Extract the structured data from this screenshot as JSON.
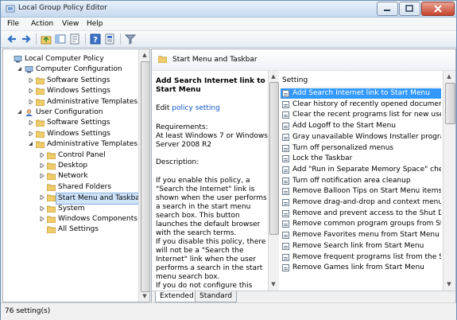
{
  "window": {
    "title": "Local Group Policy Editor"
  },
  "menu": [
    "File",
    "Action",
    "View",
    "Help"
  ],
  "toolbar_icons": [
    "back-arrow-icon",
    "forward-arrow-icon",
    "up-folder-icon",
    "show-hide-tree-icon",
    "export-list-icon",
    "help-icon",
    "properties-icon",
    "filter-icon"
  ],
  "tree": [
    {
      "label": "Local Computer Policy",
      "level": 0,
      "expander": "none",
      "icon": "computer"
    },
    {
      "label": "Computer Configuration",
      "level": 1,
      "expander": "open",
      "icon": "computer"
    },
    {
      "label": "Software Settings",
      "level": 2,
      "expander": "closed",
      "icon": "folder"
    },
    {
      "label": "Windows Settings",
      "level": 2,
      "expander": "closed",
      "icon": "folder"
    },
    {
      "label": "Administrative Templates",
      "level": 2,
      "expander": "closed",
      "icon": "folder"
    },
    {
      "label": "User Configuration",
      "level": 1,
      "expander": "open",
      "icon": "user"
    },
    {
      "label": "Software Settings",
      "level": 2,
      "expander": "closed",
      "icon": "folder"
    },
    {
      "label": "Windows Settings",
      "level": 2,
      "expander": "closed",
      "icon": "folder"
    },
    {
      "label": "Administrative Templates",
      "level": 2,
      "expander": "open",
      "icon": "folder"
    },
    {
      "label": "Control Panel",
      "level": 3,
      "expander": "closed",
      "icon": "folder"
    },
    {
      "label": "Desktop",
      "level": 3,
      "expander": "closed",
      "icon": "folder"
    },
    {
      "label": "Network",
      "level": 3,
      "expander": "closed",
      "icon": "folder"
    },
    {
      "label": "Shared Folders",
      "level": 3,
      "expander": "none",
      "icon": "folder"
    },
    {
      "label": "Start Menu and Taskbar",
      "level": 3,
      "expander": "closed",
      "icon": "folder",
      "selected": true
    },
    {
      "label": "System",
      "level": 3,
      "expander": "closed",
      "icon": "folder"
    },
    {
      "label": "Windows Components",
      "level": 3,
      "expander": "closed",
      "icon": "folder"
    },
    {
      "label": "All Settings",
      "level": 3,
      "expander": "none",
      "icon": "folder"
    }
  ],
  "right_header": "Start Menu and Taskbar",
  "description": {
    "title": "Add Search Internet link to Start Menu",
    "edit_prefix": "Edit ",
    "edit_link": "policy setting",
    "requirements_label": "Requirements:",
    "requirements": "At least Windows 7 or Windows Server 2008 R2",
    "description_label": "Description:",
    "para1": "If you enable this policy, a \"Search the Internet\" link is shown when the user performs a search in the start menu search box. This button launches the default browser with the search terms.",
    "para2": "If you disable this policy, there will not be a \"Search the Internet\" link when the user performs a search in the start menu search box.",
    "para3": "If you do not configure this policy"
  },
  "list_header": "Setting",
  "settings": [
    "Add Search Internet link to Start Menu",
    "Clear history of recently opened documents on exit",
    "Clear the recent programs list for new users",
    "Add Logoff to the Start Menu",
    "Gray unavailable Windows Installer programs Start Menu",
    "Turn off personalized menus",
    "Lock the Taskbar",
    "Add \"Run in Separate Memory Space\" check box",
    "Turn off notification area cleanup",
    "Remove Balloon Tips on Start Menu items",
    "Remove drag-and-drop and context menus on the Start",
    "Remove and prevent access to the Shut Down, Restart",
    "Remove common program groups from Start Menu",
    "Remove Favorites menu from Start Menu",
    "Remove Search link from Start Menu",
    "Remove frequent programs list from the Start Menu",
    "Remove Games link from Start Menu"
  ],
  "tabs": [
    "Extended",
    "Standard"
  ],
  "status": "76 setting(s)"
}
